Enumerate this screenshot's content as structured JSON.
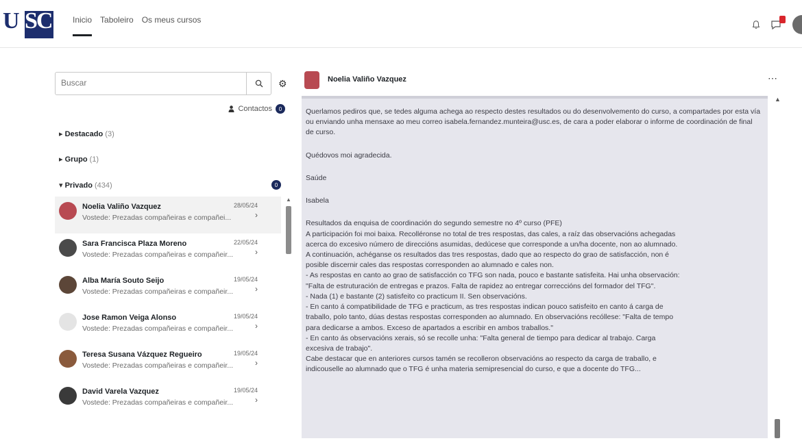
{
  "navbar": {
    "logo_text": "USC",
    "links": [
      "Inicio",
      "Taboleiro",
      "Os meus cursos"
    ],
    "active_link": 0
  },
  "left": {
    "search_placeholder": "Buscar",
    "contacts_label": "Contactos",
    "contacts_count": "0",
    "sections": {
      "starred": {
        "label": "Destacado",
        "count": "(3)"
      },
      "group": {
        "label": "Grupo",
        "count": "(1)"
      },
      "private": {
        "label": "Privado",
        "count": "(434)",
        "badge": "0"
      }
    },
    "conversations": [
      {
        "name": "Noelia Valiño Vazquez",
        "date": "28/05/24",
        "preview": "Vostede: Prezadas compañeiras e compañei...",
        "avatar_color": "#b84a52"
      },
      {
        "name": "Sara Francisca Plaza Moreno",
        "date": "22/05/24",
        "preview": "Vostede: Prezadas compañeiras e compañeir...",
        "avatar_color": "#4a4a4a"
      },
      {
        "name": "Alba María Souto Seijo",
        "date": "19/05/24",
        "preview": "Vostede: Prezadas compañeiras e compañeir...",
        "avatar_color": "#5c4638"
      },
      {
        "name": "Jose Ramon Veiga Alonso",
        "date": "19/05/24",
        "preview": "Vostede: Prezadas compañeiras e compañeir...",
        "avatar_color": "#e4e4e4"
      },
      {
        "name": "Teresa Susana Vázquez Regueiro",
        "date": "19/05/24",
        "preview": "Vostede: Prezadas compañeiras e compañeir...",
        "avatar_color": "#8a5a3c"
      },
      {
        "name": "David Varela Vazquez",
        "date": "19/05/24",
        "preview": "Vostede: Prezadas compañeiras e compañeir...",
        "avatar_color": "#3a3a3a"
      }
    ]
  },
  "right": {
    "contact_name": "Noelia Valiño Vazquez",
    "message_paragraphs": [
      "Querlamos pediros que, se tedes alguma achega ao respecto destes resultados ou do desenvolvemento do curso, a compartades por esta vía ou enviando unha mensaxe ao meu correo isabela.fernandez.munteira@usc.es, de cara a poder elaborar o informe de coordinación de final de curso.",
      "Quédovos moi agradecida.",
      "Saúde",
      "Isabela",
      "Resultados da enquisa de coordinación do segundo semestre no 4º curso (PFE)"
    ],
    "message_body_lines": [
      "A participación foi moi baixa. Recolléronse no total de tres respostas, das cales, a raíz das observacións achegadas",
      "acerca do excesivo número de direccións asumidas, dedúcese que corresponde a un/ha docente, non ao alumnado.",
      "A continuación, achéganse os resultados das tres respostas, dado que ao respecto do grao de satisfacción, non é",
      "posible discernir cales das respostas corresponden ao alumnado e cales non.",
      "- As respostas en canto ao grao de satisfacción co TFG son nada, pouco e bastante satisfeita. Hai unha observación:",
      "\"Falta de estruturación de entregas e prazos. Falta de rapidez ao entregar correccións del formador del TFG\".",
      "- Nada (1) e bastante (2) satisfeito co practicum II. Sen observacións.",
      "- En canto á compatibilidade de TFG e practicum, as tres respostas indican pouco satisfeito en canto á carga de",
      "traballo, polo tanto, dúas destas respostas corresponden ao alumnado. En observacións recóllese: \"Falta de tempo",
      "para dedicarse a ambos. Exceso de apartados a escribir en ambos traballos.\"",
      "- En canto ás observacións xerais, só se recolle unha: \"Falta general de tiempo para dedicar al trabajo. Carga",
      "excesiva de trabajo\".",
      "Cabe destacar que en anteriores cursos tamén se recolleron observacións ao respecto da carga de traballo, e",
      "indicouselle ao alumnado que o TFG é unha materia semipresencial do curso, e que a docente do TFG..."
    ]
  }
}
